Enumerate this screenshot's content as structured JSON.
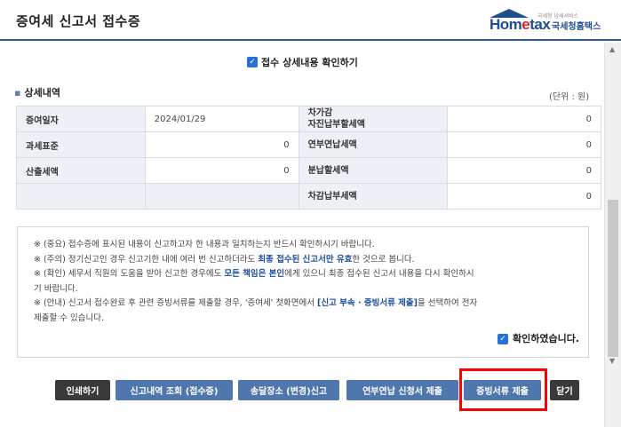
{
  "window": {
    "title": "증여세 신고서 접수증"
  },
  "logo": {
    "brand_prefix": "Hom",
    "brand_e": "e",
    "brand_suffix": "tax",
    "tagline": "국세청 납세서비스",
    "korean": "국세청홈택스"
  },
  "confirm_top": {
    "label": "접수 상세내용 확인하기",
    "checked": true
  },
  "section": {
    "title": "상세내역",
    "unit": "(단위 : 원)"
  },
  "table": {
    "rows": [
      {
        "l1": "증여일자",
        "v1": "2024/01/29",
        "l2a": "차가감",
        "l2b": "자진납부할세액",
        "v2": "0"
      },
      {
        "l1": "과세표준",
        "v1": "0",
        "l2a": "연부연납세액",
        "l2b": "",
        "v2": "0"
      },
      {
        "l1": "산출세액",
        "v1": "0",
        "l2a": "분납할세액",
        "l2b": "",
        "v2": "0"
      },
      {
        "l1": "",
        "v1": "",
        "l2a": "차감납부세액",
        "l2b": "",
        "v2": "0"
      }
    ]
  },
  "notice": {
    "line1": "※ (중요) 접수증에 표시된 내용이 신고하고자 한 내용과 일치하는지 반드시 확인하시기 바랍니다.",
    "line2_a": "※ (주의) 정기신고인 경우 신고기한 내에 여러 번 신고하더라도 ",
    "line2_hl": "최종 접수된 신고서만 유효",
    "line2_b": "한 것으로 봅니다.",
    "line3_a": "※ (확인) 세무서 직원의 도움을 받아 신고한 경우에도 ",
    "line3_hl": "모든 책임은 본인",
    "line3_b": "에게 있으니 최종 접수된 신고서 내용을 다시 확인하시",
    "line3_c": "기 바랍니다.",
    "line4_a": "※ (안내) 신고서 접수완료 후 관련 증빙서류를 제출할 경우, '증여세' 첫화면에서 ",
    "line4_hl": "[신고 부속 · 증빙서류 제출]",
    "line4_b": "을 선택하여 전자",
    "line4_c": "제출할 수 있습니다.",
    "ack_label": "확인하였습니다.",
    "ack_checked": true
  },
  "buttons": {
    "print": "인쇄하기",
    "history": "신고내역 조회 (접수증)",
    "delivery": "송달장소 (변경)신고",
    "installment": "연부연납 신청서 제출",
    "evidence": "증빙서류 제출",
    "close": "닫기"
  },
  "colors": {
    "accent": "#4f77ae",
    "highlight": "#ff0000",
    "header_line": "#2e5a8c"
  }
}
